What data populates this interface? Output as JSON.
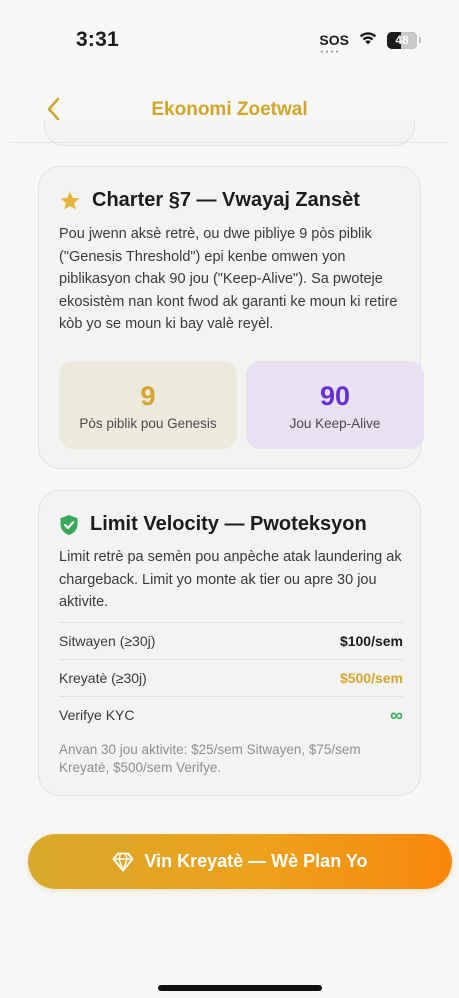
{
  "status_bar": {
    "time": "3:31",
    "sos": "SOS",
    "battery": "48",
    "battery_fraction": 0.48
  },
  "nav": {
    "title": "Ekonomi Zoetwal",
    "back_icon": "chevron-left-icon"
  },
  "charter": {
    "icon": "star-icon",
    "title": "Charter §7 — Vwayaj Zansèt",
    "body": "Pou jwenn aksè retrè, ou dwe pibliye 9 pòs piblik (\"Genesis Threshold\") epi kenbe omwen yon piblikasyon chak 90 jou (\"Keep-Alive\"). Sa pwoteje ekosistèm nan kont fwod ak garanti ke moun ki retire kòb yo se moun ki bay valè reyèl.",
    "stats": [
      {
        "value": "9",
        "label": "Pòs piblik pou Genesis",
        "color": "#d6a52e"
      },
      {
        "value": "90",
        "label": "Jou Keep-Alive",
        "color": "#6a2fd3"
      }
    ]
  },
  "velocity": {
    "icon": "shield-check-icon",
    "title": "Limit Velocity — Pwoteksyon",
    "body": "Limit retrè pa semèn pou anpèche atak laundering ak chargeback. Limit yo monte ak tier ou apre 30 jou aktivite.",
    "rows": [
      {
        "label": "Sitwayen (≥30j)",
        "value": "$100/sem"
      },
      {
        "label": "Kreyatè (≥30j)",
        "value": "$500/sem"
      },
      {
        "label": "Verifye KYC",
        "value": "∞"
      }
    ],
    "note": "Anvan 30 jou aktivite: $25/sem Sitwayen, $75/sem Kreyatè, $500/sem Verifye."
  },
  "cta": {
    "icon": "diamond-icon",
    "label": "Vin Kreyatè — Wè Plan Yo"
  },
  "colors": {
    "accent_gold": "#d2a52a",
    "accent_purple": "#6a2fd3",
    "success_green": "#3aa85a",
    "cta_gradient_start": "#d8a92c",
    "cta_gradient_end": "#f8870c"
  }
}
